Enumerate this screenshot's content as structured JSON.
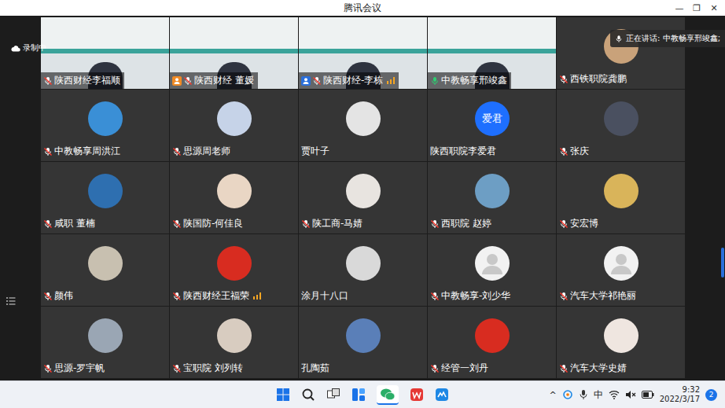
{
  "window": {
    "title": "腾讯会议",
    "controls": [
      "—",
      "❐",
      "✕"
    ]
  },
  "recording": {
    "label": "录制中"
  },
  "speaking": {
    "label": "正在讲话: 中教畅享邢竣鑫;"
  },
  "participants": [
    {
      "name": "陕西财经李福顺",
      "kind": "video",
      "mic": "muted",
      "role": "none",
      "signal": false
    },
    {
      "name": "陕西财经 董媛",
      "kind": "video",
      "mic": "muted",
      "role": "host",
      "signal": false
    },
    {
      "name": "陕西财经-李栋",
      "kind": "video",
      "mic": "muted",
      "role": "cohost",
      "signal": true
    },
    {
      "name": "中教畅享邢竣鑫",
      "kind": "video",
      "mic": "speaking",
      "role": "none",
      "signal": false
    },
    {
      "name": "西铁职院龚鹏",
      "kind": "photo",
      "mic": "muted",
      "role": "none",
      "signal": false,
      "color": "#c9a27a"
    },
    {
      "name": "中教畅享周洪江",
      "kind": "photo",
      "mic": "muted",
      "role": "none",
      "signal": false,
      "color": "#3a8fd6"
    },
    {
      "name": "思源周老师",
      "kind": "photo",
      "mic": "muted",
      "role": "none",
      "signal": false,
      "color": "#c6d3e8"
    },
    {
      "name": "贾叶子",
      "kind": "photo",
      "mic": "none",
      "role": "none",
      "signal": false,
      "color": "#e4e4e4"
    },
    {
      "name": "陕西职院李爱君",
      "kind": "text",
      "mic": "none",
      "role": "none",
      "signal": false,
      "color": "#1e6fff",
      "avatar_text": "爱君"
    },
    {
      "name": "张庆",
      "kind": "photo",
      "mic": "muted",
      "role": "none",
      "signal": false,
      "color": "#4a5060"
    },
    {
      "name": "咸职 董楠",
      "kind": "photo",
      "mic": "muted",
      "role": "none",
      "signal": false,
      "color": "#2e6fb0"
    },
    {
      "name": "陕国防-何佳良",
      "kind": "photo",
      "mic": "muted",
      "role": "none",
      "signal": false,
      "color": "#e9d6c4"
    },
    {
      "name": "陕工商-马婧",
      "kind": "photo",
      "mic": "muted",
      "role": "none",
      "signal": false,
      "color": "#e8e4e0"
    },
    {
      "name": "西职院 赵婷",
      "kind": "photo",
      "mic": "muted",
      "role": "none",
      "signal": false,
      "color": "#6d9ec4"
    },
    {
      "name": "安宏博",
      "kind": "photo",
      "mic": "muted",
      "role": "none",
      "signal": false,
      "color": "#d9b45a"
    },
    {
      "name": "颜伟ゞ",
      "kind": "photo",
      "mic": "muted",
      "role": "none",
      "signal": false,
      "color": "#c8c0b0"
    },
    {
      "name": "陕西财经王福荣",
      "kind": "photo",
      "mic": "muted",
      "role": "none",
      "signal": true,
      "color": "#d82c20"
    },
    {
      "name": "涂月十八口",
      "kind": "photo",
      "mic": "none",
      "role": "none",
      "signal": false,
      "color": "#d9d9d9"
    },
    {
      "name": "中教畅享-刘少华",
      "kind": "default",
      "mic": "muted",
      "role": "none",
      "signal": false
    },
    {
      "name": "汽车大学祁艳丽",
      "kind": "default",
      "mic": "muted",
      "role": "none",
      "signal": false
    },
    {
      "name": "思源-罗宇帆",
      "kind": "photo",
      "mic": "muted",
      "role": "none",
      "signal": false,
      "color": "#9aa6b4"
    },
    {
      "name": "宝职院 刘列转",
      "kind": "photo",
      "mic": "muted",
      "role": "none",
      "signal": false,
      "color": "#d8ccc0"
    },
    {
      "name": "孔陶茹",
      "kind": "photo",
      "mic": "none",
      "role": "none",
      "signal": false,
      "color": "#5a7fb8"
    },
    {
      "name": "经管一刘丹",
      "kind": "photo",
      "mic": "muted",
      "role": "none",
      "signal": false,
      "color": "#d82c20"
    },
    {
      "name": "汽车大学史婧",
      "kind": "photo",
      "mic": "muted",
      "role": "none",
      "signal": false,
      "color": "#efe6e0"
    }
  ],
  "taskbar": {
    "caret": "^",
    "ime": "中",
    "time": "9:32",
    "date": "2022/3/17",
    "notifications": "2"
  }
}
